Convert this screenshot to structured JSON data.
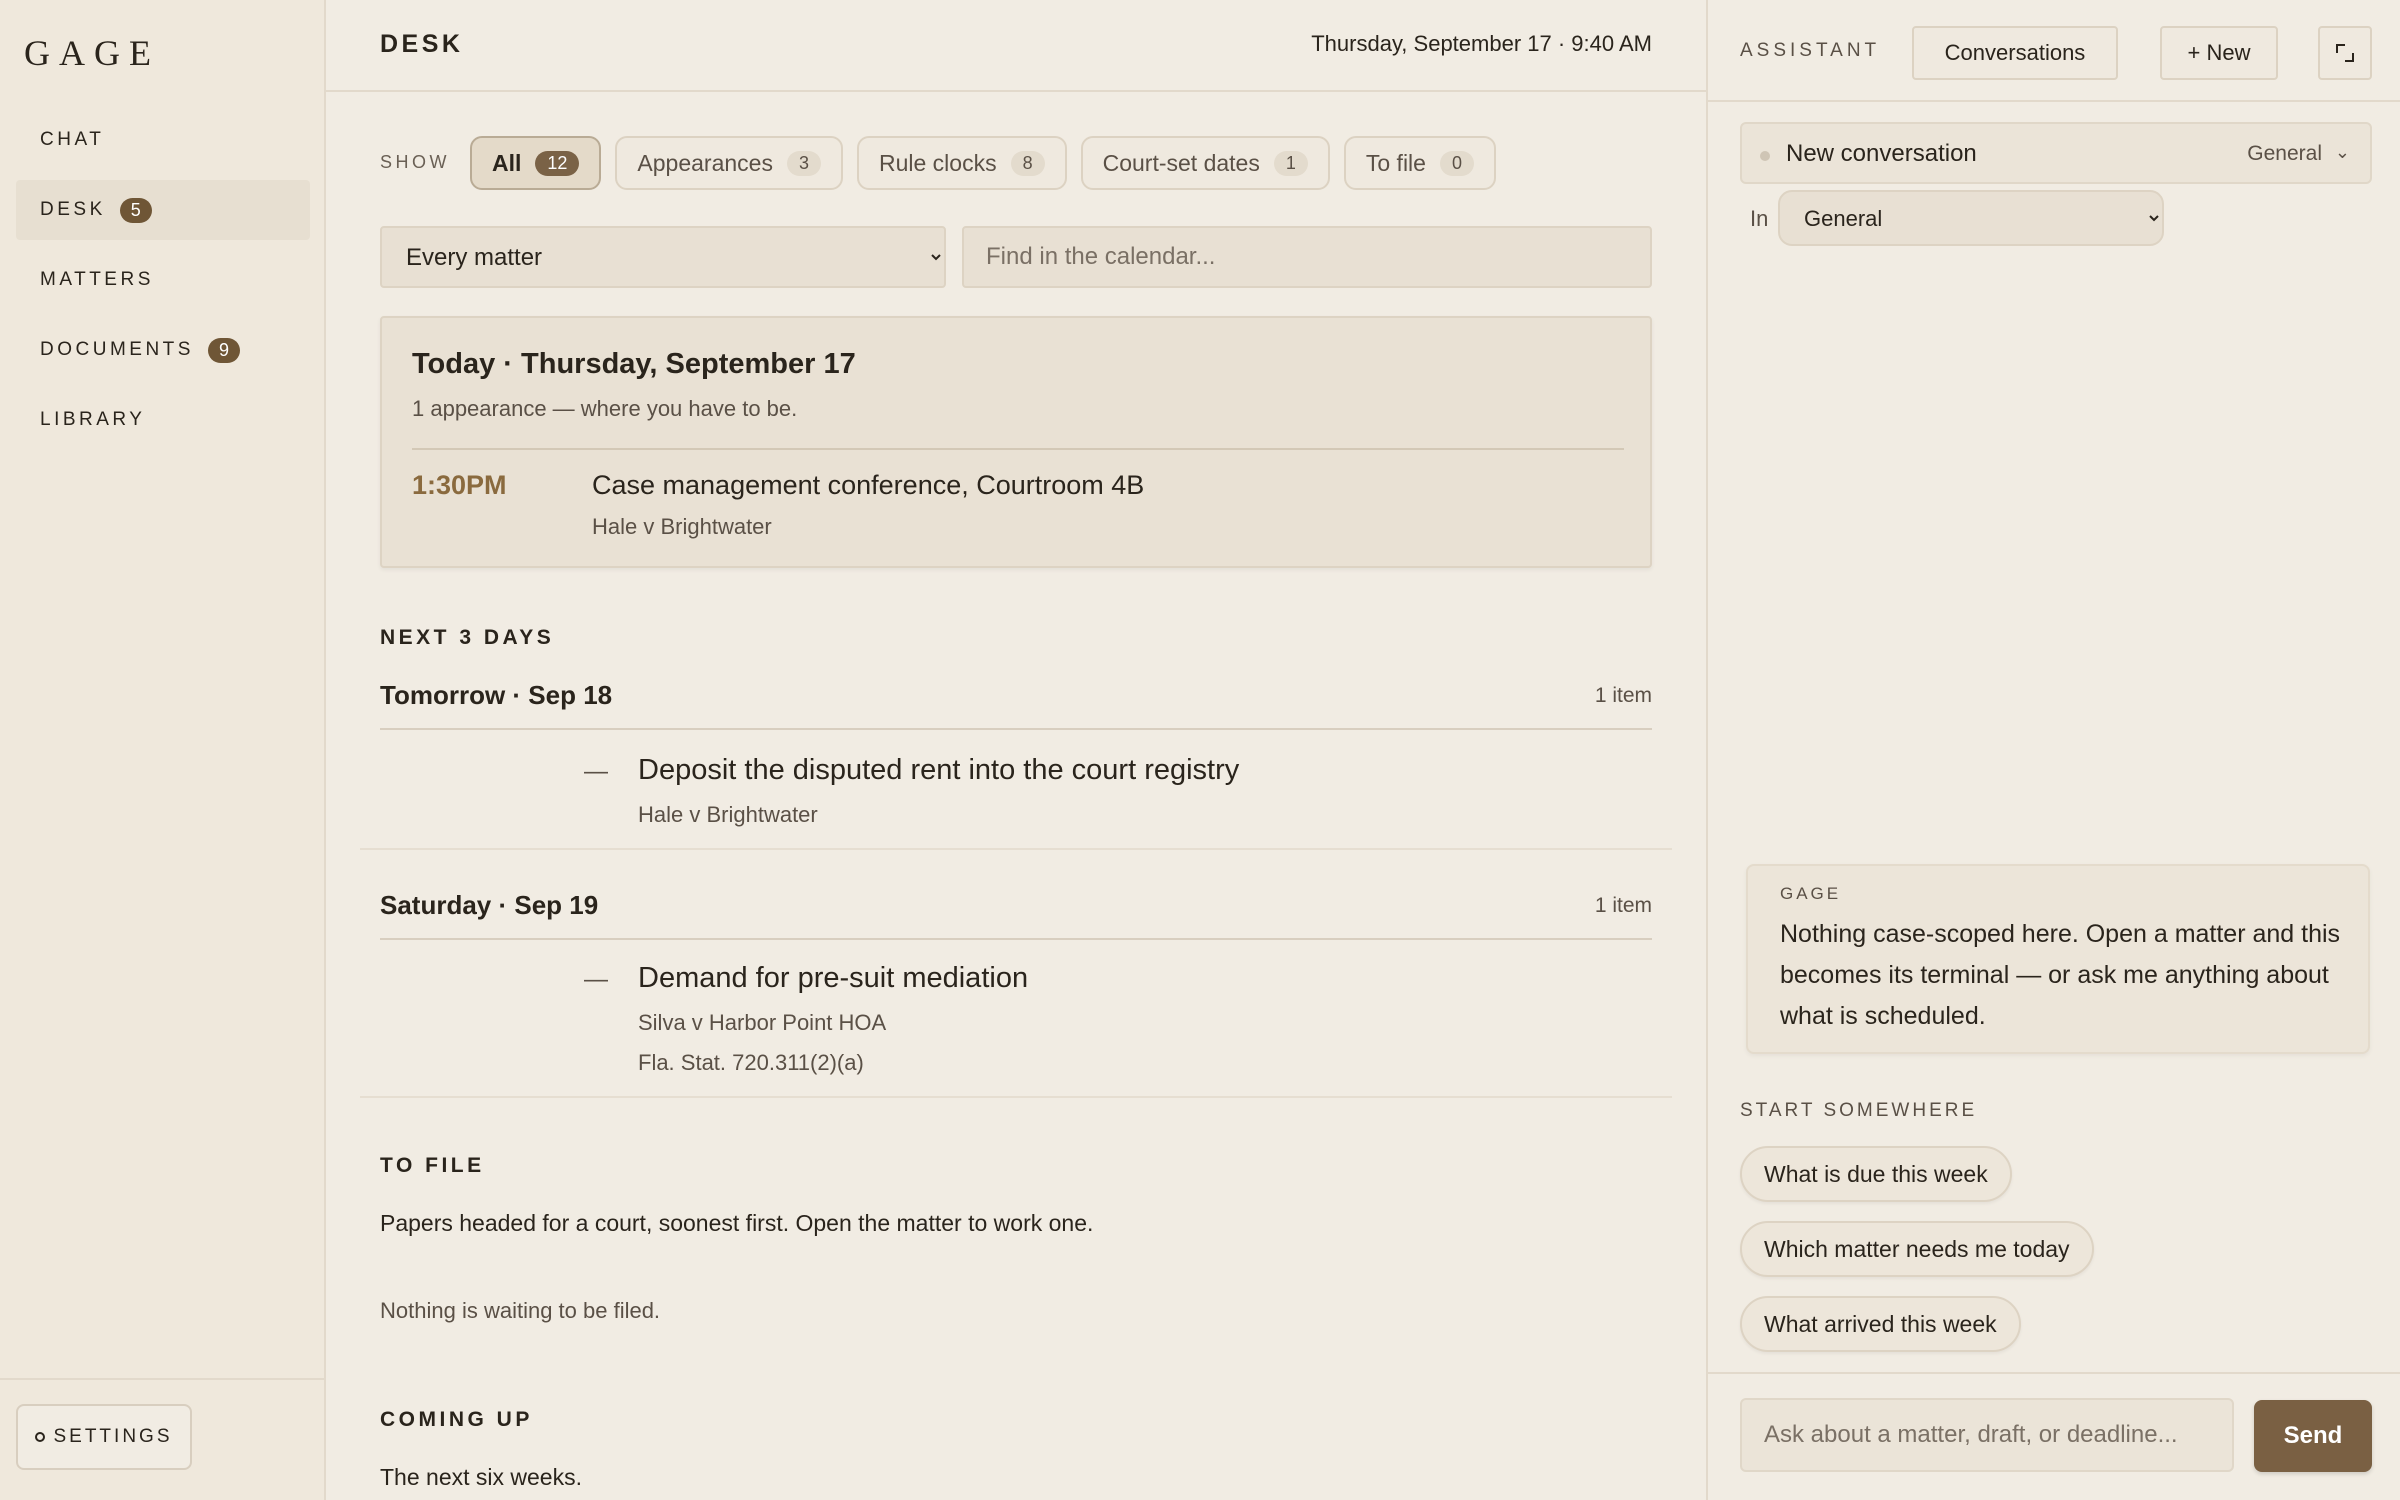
{
  "app": {
    "logo": "GAGE"
  },
  "sidebar": {
    "items": [
      {
        "label": "CHAT",
        "badge": null
      },
      {
        "label": "DESK",
        "badge": "5"
      },
      {
        "label": "MATTERS",
        "badge": null
      },
      {
        "label": "DOCUMENTS",
        "badge": "9"
      },
      {
        "label": "LIBRARY",
        "badge": null
      }
    ],
    "settings_label": "SETTINGS"
  },
  "main": {
    "title": "DESK",
    "date": "Thursday, September 17 · 9:40 AM",
    "show_label": "SHOW",
    "filters": [
      {
        "label": "All",
        "count": "12"
      },
      {
        "label": "Appearances",
        "count": "3"
      },
      {
        "label": "Rule clocks",
        "count": "8"
      },
      {
        "label": "Court-set dates",
        "count": "1"
      },
      {
        "label": "To file",
        "count": "0"
      }
    ],
    "matter_select": {
      "selected": "Every matter"
    },
    "search": {
      "placeholder": "Find in the calendar..."
    },
    "today": {
      "title": "Today · Thursday, September 17",
      "subtitle": "1 appearance — where you have to be.",
      "appointment": {
        "time": "1:30PM",
        "title": "Case management conference, Courtroom 4B",
        "matter": "Hale v Brightwater"
      }
    },
    "next_days": {
      "label": "NEXT 3 DAYS",
      "days": [
        {
          "name": "Tomorrow · Sep 18",
          "count": "1 item",
          "items": [
            {
              "dash": "—",
              "title": "Deposit the disputed rent into the court registry",
              "matter": "Hale v Brightwater",
              "cite": ""
            }
          ]
        },
        {
          "name": "Saturday · Sep 19",
          "count": "1 item",
          "items": [
            {
              "dash": "—",
              "title": "Demand for pre-suit mediation",
              "matter": "Silva v Harbor Point HOA",
              "cite": "Fla. Stat. 720.311(2)(a)"
            }
          ]
        }
      ]
    },
    "to_file": {
      "label": "TO FILE",
      "description": "Papers headed for a court, soonest first. Open the matter to work one.",
      "empty": "Nothing is waiting to be filed."
    },
    "coming_up": {
      "label": "COMING UP",
      "description": "The next six weeks."
    }
  },
  "assistant": {
    "label": "ASSISTANT",
    "conversations_button": "Conversations",
    "new_button": "+ New",
    "conversation": {
      "title": "New conversation",
      "scope": "General",
      "chevron": "⌄"
    },
    "in_label": "In",
    "scope_select": {
      "selected": "General"
    },
    "message": {
      "author": "GAGE",
      "text": "Nothing case-scoped here. Open a matter and this becomes its terminal — or ask me anything about what is scheduled."
    },
    "start_label": "START SOMEWHERE",
    "suggestions": [
      "What is due this week",
      "Which matter needs me today",
      "What arrived this week"
    ],
    "input": {
      "placeholder": "Ask about a matter, draft, or deadline..."
    },
    "send_button": "Send"
  }
}
